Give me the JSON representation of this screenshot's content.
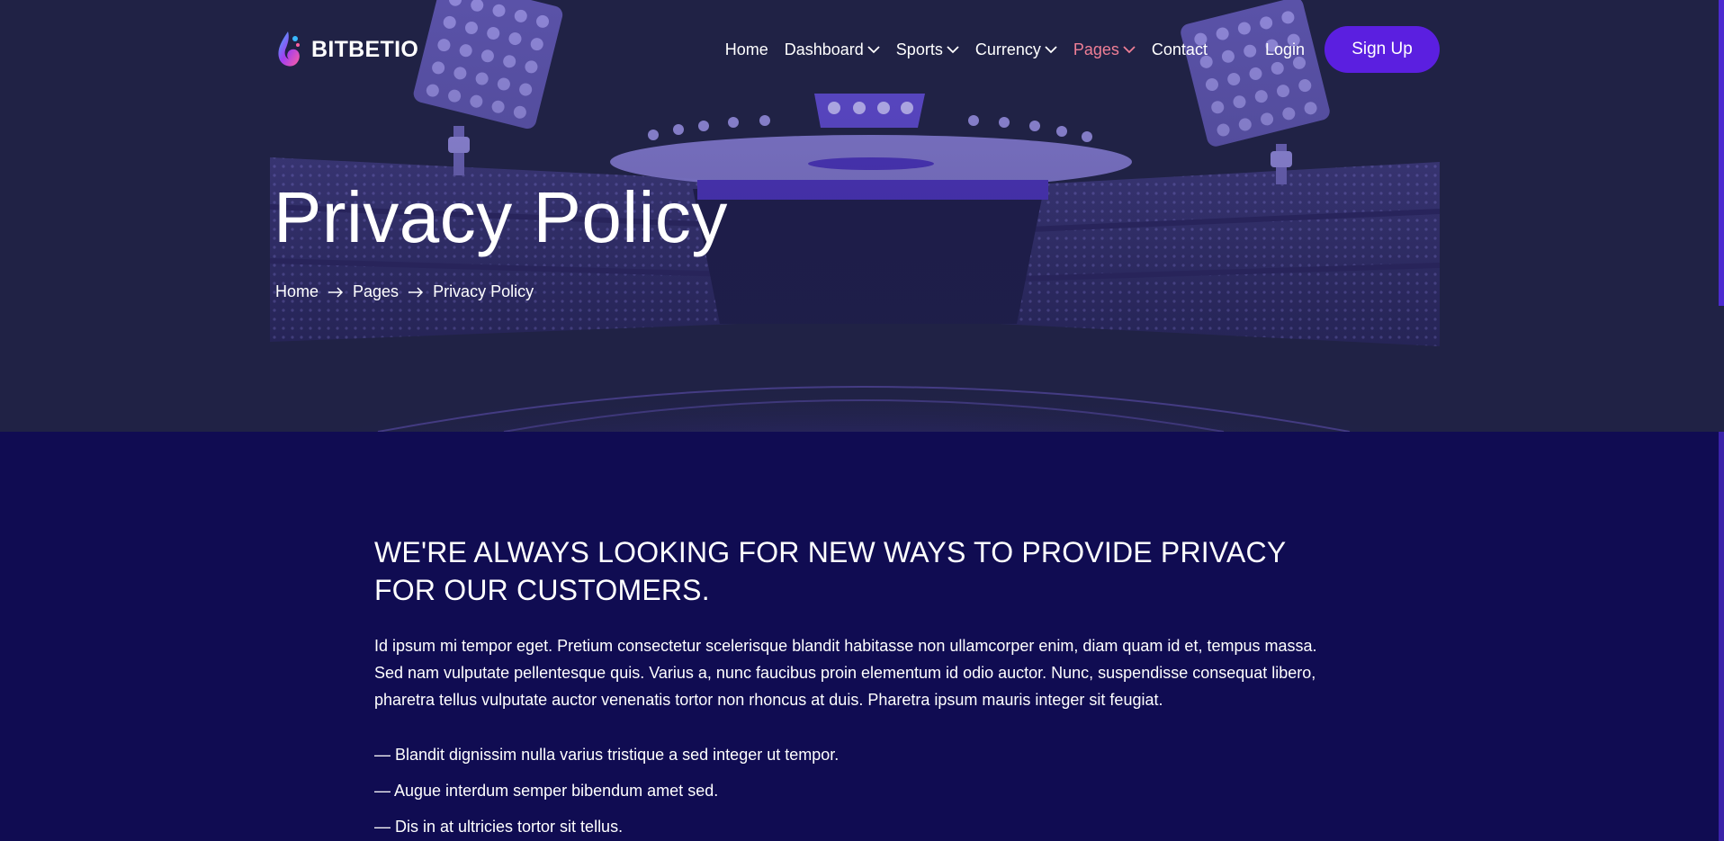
{
  "brand": {
    "name": "BITBETIO",
    "logo_icon": "flame-drop-icon"
  },
  "nav": {
    "items": [
      {
        "label": "Home",
        "has_dropdown": false,
        "active": false
      },
      {
        "label": "Dashboard",
        "has_dropdown": true,
        "active": false
      },
      {
        "label": "Sports",
        "has_dropdown": true,
        "active": false
      },
      {
        "label": "Currency",
        "has_dropdown": true,
        "active": false
      },
      {
        "label": "Pages",
        "has_dropdown": true,
        "active": true
      },
      {
        "label": "Contact",
        "has_dropdown": false,
        "active": false
      }
    ],
    "login_label": "Login",
    "signup_label": "Sign Up"
  },
  "hero": {
    "title": "Privacy Policy",
    "breadcrumb": [
      "Home",
      "Pages",
      "Privacy Policy"
    ]
  },
  "main": {
    "heading": "WE'RE ALWAYS LOOKING FOR NEW WAYS TO PROVIDE PRIVACY FOR OUR CUSTOMERS.",
    "paragraph": "Id ipsum mi tempor eget. Pretium consectetur scelerisque blandit habitasse non ullamcorper enim, diam quam id et, tempus massa. Sed nam vulputate pellentesque quis. Varius a, nunc faucibus proin elementum id odio auctor. Nunc, suspendisse consequat libero, pharetra tellus vulputate auctor venenatis tortor non rhoncus at duis. Pharetra ipsum mauris integer sit feugiat.",
    "bullets": [
      "— Blandit dignissim nulla varius tristique a sed integer ut tempor.",
      "— Augue interdum semper bibendum amet sed.",
      "— Dis in at ultricies tortor sit tellus."
    ]
  },
  "colors": {
    "hero_bg": "#202245",
    "content_bg": "#100c52",
    "accent": "#5b1fe0",
    "active_nav": "#ef7f96",
    "stadium": "#4a33b8"
  }
}
